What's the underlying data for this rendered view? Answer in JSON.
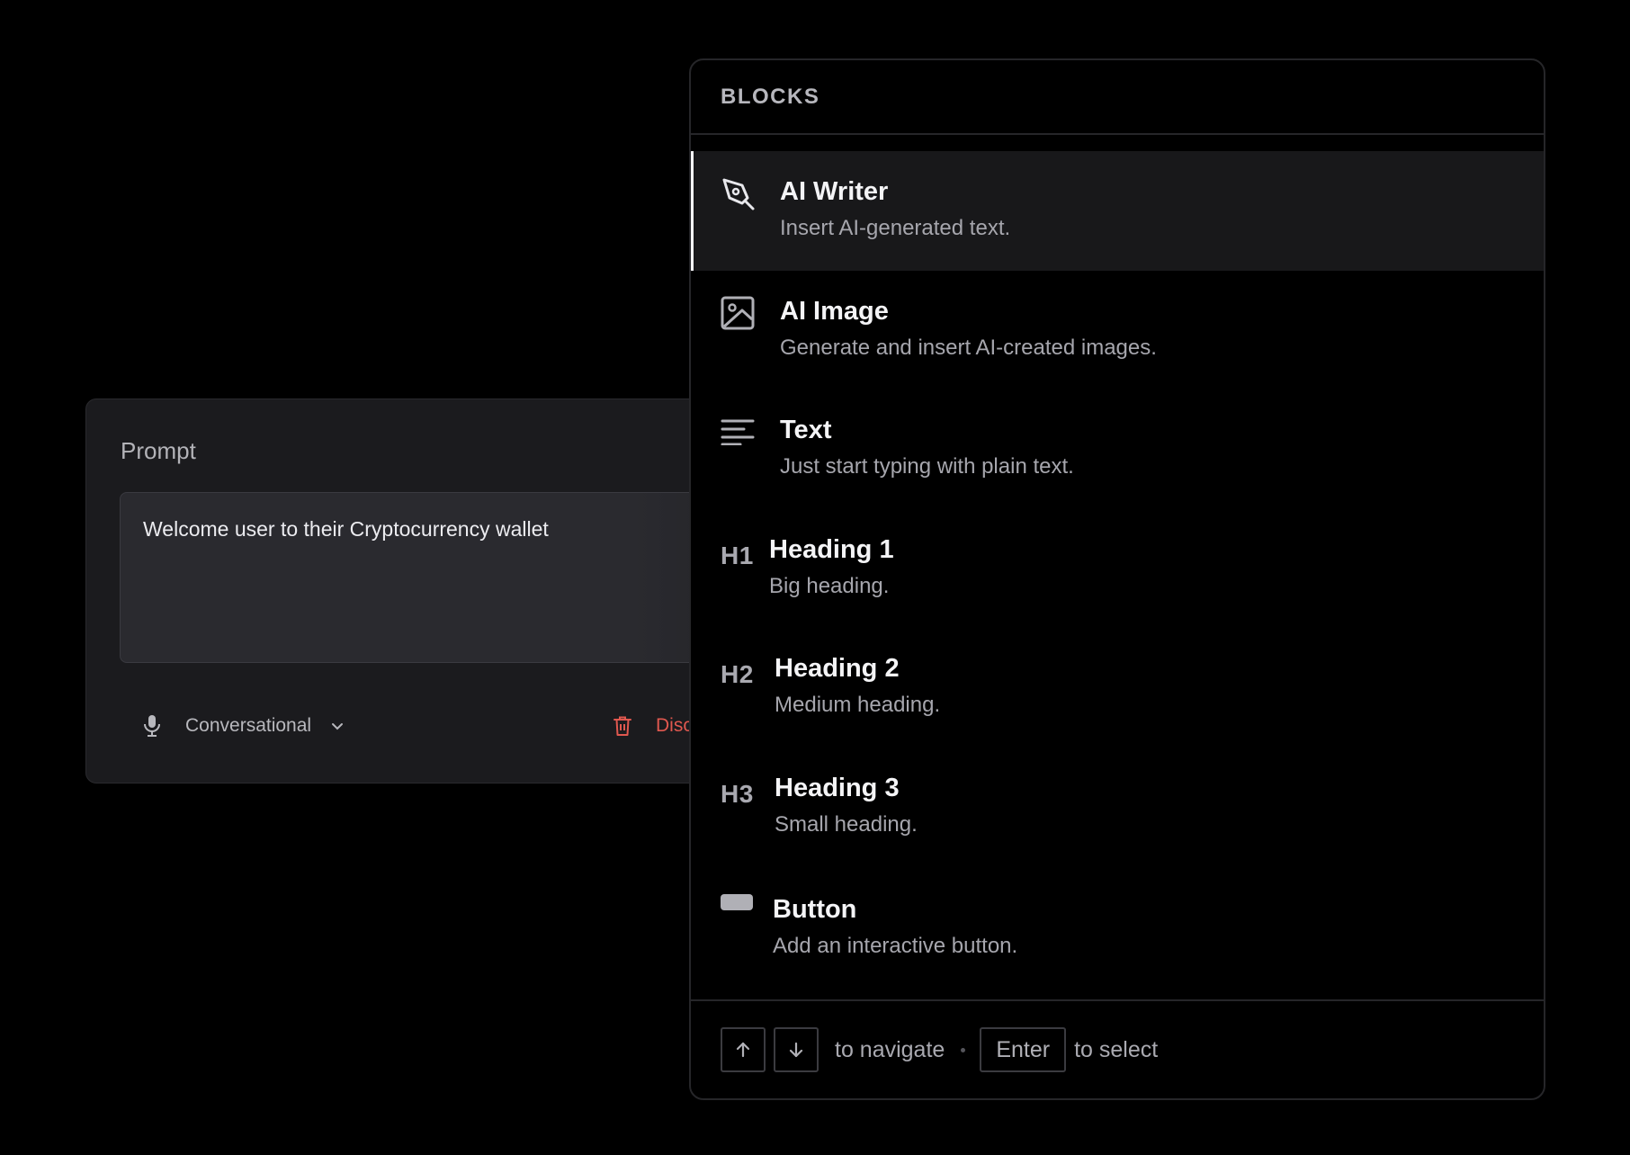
{
  "prompt": {
    "label": "Prompt",
    "value": "Welcome user to their Cryptocurrency wallet",
    "voice": "Conversational",
    "discard_label": "Disc"
  },
  "blocks_menu": {
    "header": "BLOCKS",
    "items": [
      {
        "title": "AI Writer",
        "description": "Insert AI-generated text.",
        "icon": "pen-nib-icon",
        "active": true
      },
      {
        "title": "AI Image",
        "description": "Generate and insert AI-created images.",
        "icon": "image-icon"
      },
      {
        "title": "Text",
        "description": "Just start typing with plain text.",
        "icon": "text-lines-icon"
      },
      {
        "title": "Heading 1",
        "description": "Big heading.",
        "icon": "heading-1-icon",
        "glyph": "H1"
      },
      {
        "title": "Heading 2",
        "description": "Medium heading.",
        "icon": "heading-2-icon",
        "glyph": "H2"
      },
      {
        "title": "Heading 3",
        "description": "Small heading.",
        "icon": "heading-3-icon",
        "glyph": "H3"
      },
      {
        "title": "Button",
        "description": "Add an interactive button.",
        "icon": "button-icon"
      }
    ],
    "footer": {
      "navigate_text": "to navigate",
      "enter_key": "Enter",
      "select_text": "to select"
    }
  },
  "colors": {
    "background": "#000000",
    "card": "#1b1b1e",
    "danger": "#e0584f",
    "active_row": "#18181a"
  }
}
